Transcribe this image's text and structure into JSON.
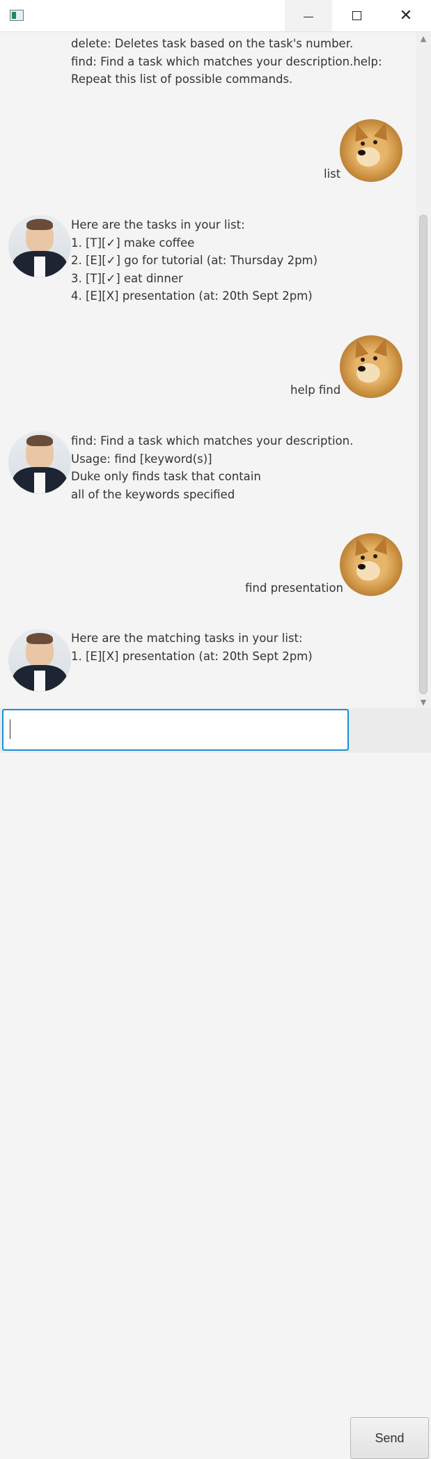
{
  "window": {
    "title": ""
  },
  "chat": {
    "messages": [
      {
        "sender": "duke",
        "lines": [
          "delete: Deletes task based on the task's number.",
          "find: Find a task which matches your description.help:",
          "Repeat this list of possible commands."
        ]
      },
      {
        "sender": "user",
        "lines": [
          "list"
        ]
      },
      {
        "sender": "duke",
        "lines": [
          "Here are the tasks in your list:",
          "1. [T][✓] make coffee",
          "2. [E][✓] go for tutorial (at: Thursday 2pm)",
          "3. [T][✓] eat dinner",
          "4. [E][X] presentation (at: 20th Sept 2pm)"
        ]
      },
      {
        "sender": "user",
        "lines": [
          "help find"
        ]
      },
      {
        "sender": "duke",
        "lines": [
          "find: Find a task which matches your description.",
          "Usage: find [keyword(s)]",
          "Duke only finds task that contain",
          "all of the keywords specified"
        ]
      },
      {
        "sender": "user",
        "lines": [
          "find presentation"
        ]
      },
      {
        "sender": "duke",
        "lines": [
          "Here are the matching tasks in your list:",
          "1. [E][X] presentation (at: 20th Sept 2pm)"
        ]
      }
    ]
  },
  "input": {
    "value": "",
    "placeholder": ""
  },
  "send_button": {
    "label": "Send"
  },
  "icons": {
    "app": "app-icon",
    "minimize": "minimize-icon",
    "maximize": "maximize-icon",
    "close": "close-icon",
    "scroll_up": "chevron-up-icon",
    "scroll_down": "chevron-down-icon"
  },
  "colors": {
    "input_focus": "#1a8fd6",
    "background": "#f4f4f4"
  }
}
